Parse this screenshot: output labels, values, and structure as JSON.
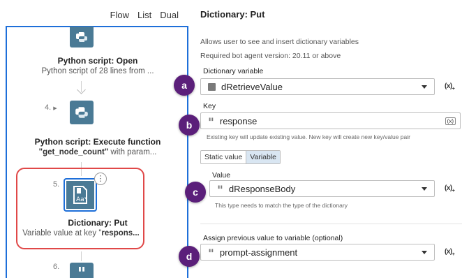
{
  "view_tabs": [
    "Flow",
    "List",
    "Dual"
  ],
  "flow": {
    "nodes": [
      {
        "number": "",
        "title": "Python script: Open",
        "desc": "Python script of 28 lines from ...",
        "icon": "python-icon"
      },
      {
        "number": "4.",
        "title": "Python script: Execute function",
        "desc_bold": "\"get_node_count\"",
        "desc": " with param...",
        "icon": "python-icon"
      },
      {
        "number": "5.",
        "title": "Dictionary: Put",
        "desc": "Variable value at key \"",
        "desc_bold": "respons...",
        "icon": "dictionary-icon"
      },
      {
        "number": "6.",
        "icon": "quote-icon"
      }
    ],
    "more_label": "⋮"
  },
  "panel": {
    "title": "Dictionary: Put",
    "description": "Allows user to see and insert dictionary variables",
    "version": "Required bot agent version: 20.11 or above",
    "dict_label": "Dictionary variable",
    "dict_value": "dRetrieveValue",
    "key_label": "Key",
    "key_value": "response",
    "key_inline": "(x)",
    "key_hint": "Existing key will update existing value. New key will create new key/value pair",
    "toggle": [
      "Static value",
      "Variable"
    ],
    "value_label": "Value",
    "value_value": "dResponseBody",
    "value_hint": "This type needs to match the type of the dictionary",
    "assign_label": "Assign previous value to variable (optional)",
    "assign_value": "prompt-assignment",
    "fx_label": "(x)",
    "fx_sub": "+"
  },
  "badges": [
    "a",
    "b",
    "c",
    "d"
  ],
  "colors": {
    "accent": "#1e6fd9",
    "badge": "#5b1f7a",
    "selection": "#e04848",
    "node_icon": "#4a7a95"
  }
}
